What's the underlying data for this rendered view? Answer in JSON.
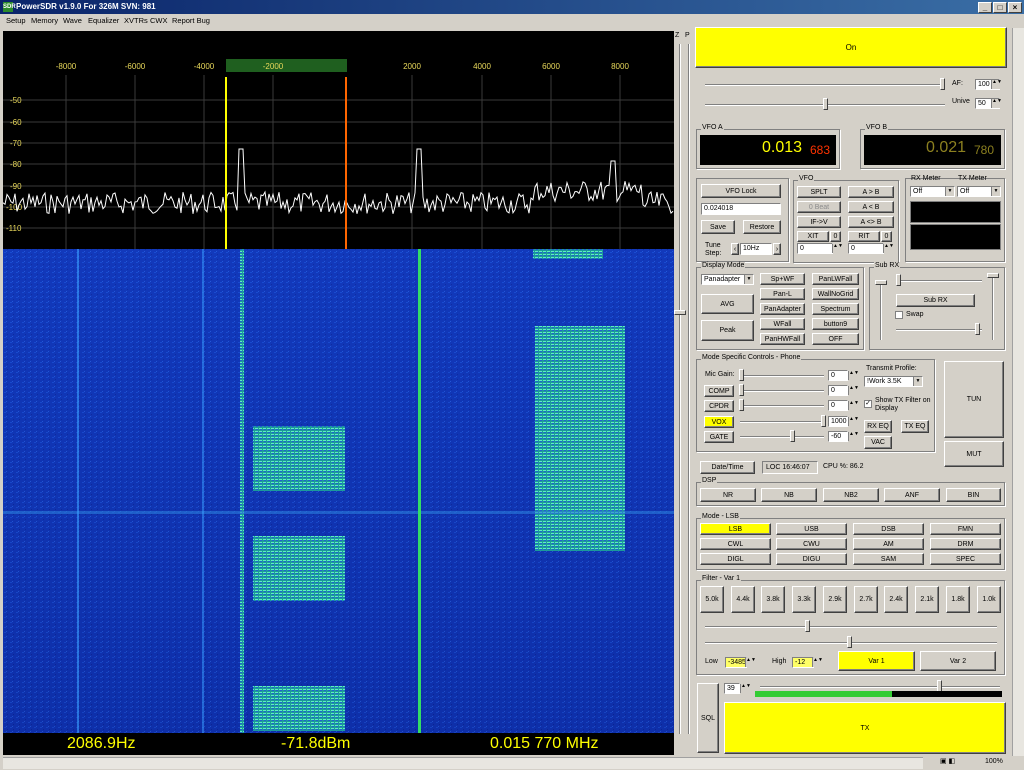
{
  "window": {
    "title": "PowerSDR v1.9.0 For 326M SVN: 981",
    "icon": "sdr-icon",
    "controls": [
      "minimize-icon",
      "maximize-icon",
      "close-icon"
    ]
  },
  "menu": [
    "Setup",
    "Memory",
    "Wave",
    "Equalizer",
    "XVTRs",
    "CWX",
    "Report Bug"
  ],
  "display": {
    "freq_ticks": [
      "-8000",
      "-6000",
      "-4000",
      "-2000",
      "2000",
      "4000",
      "6000",
      "8000"
    ],
    "db_ticks": [
      "-50",
      "-60",
      "-70",
      "-80",
      "-90",
      "-100",
      "-110"
    ],
    "filter_color": "#1f5f1f",
    "vfo_line_color": "#ff6600",
    "filter_edge_color": "#ffff00",
    "trace_color": "#ffffff",
    "waterfall_color": "#0a2aa8"
  },
  "status": {
    "cursor_freq": "2086.9Hz",
    "cursor_level": "-71.8dBm",
    "cursor_mhz": "0.015 770 MHz"
  },
  "side_strip": {
    "z": "Z",
    "p": "P"
  },
  "power_button": "On",
  "af": {
    "label": "AF:",
    "value": "100"
  },
  "usb_vol": {
    "label": "Unive",
    "value": "50"
  },
  "vfo_a": {
    "label": "VFO A",
    "main": "0.013",
    "fine": "683"
  },
  "vfo_b": {
    "label": "VFO B",
    "main": "0.021",
    "fine": "780"
  },
  "vfo_panel": {
    "lock": "VFO Lock",
    "memory_freq": "0.024018",
    "save": "Save",
    "restore": "Restore",
    "tune_step_label": "Tune Step:",
    "tune_step_value": "10Hz",
    "group_label": "VFO",
    "split": "SPLT",
    "a_to_b": "A > B",
    "zero_beat": "0 Beat",
    "b_to_a": "A < B",
    "if_v": "IF->V",
    "swap": "A <> B",
    "xit": "XIT",
    "xit_zero": "0",
    "xit_value": "0",
    "rit": "RIT",
    "rit_zero": "0",
    "rit_value": "0"
  },
  "meters": {
    "rx_label": "RX Meter",
    "rx_value": "Off",
    "tx_label": "TX Meter",
    "tx_value": "Off"
  },
  "display_mode": {
    "label": "Display Mode",
    "value": "Panadapter",
    "avg": "AVG",
    "peak": "Peak",
    "buttons": [
      "Sp+WF",
      "PanLWFall",
      "Pan-L",
      "WallNoGrid",
      "PanAdapter",
      "Spectrum",
      "WFall",
      "button9",
      "PanHWFall",
      "OFF"
    ]
  },
  "sub_rx": {
    "label": "Sub RX",
    "button": "Sub RX",
    "swap": "Swap"
  },
  "mode_controls": {
    "label": "Mode Specific Controls - Phone",
    "mic_gain": "Mic Gain:",
    "mic_value": "0",
    "comp": "COMP",
    "comp_value": "0",
    "cpdr": "CPDR",
    "cpdr_value": "0",
    "vox": "VOX",
    "vox_value": "1000",
    "gate": "GATE",
    "gate_value": "-60",
    "tx_profile_label": "Transmit Profile:",
    "tx_profile_value": "!Work 3.5K",
    "show_tx_filter": "Show TX Filter on Display",
    "rx_eq": "RX EQ",
    "tx_eq": "TX EQ",
    "vac": "VAC"
  },
  "tun": "TUN",
  "mut": "MUT",
  "info": {
    "date_time": "Date/Time",
    "loc": "LOC 16:46:07",
    "cpu": "CPU %: 86.2"
  },
  "dsp": {
    "label": "DSP",
    "buttons": [
      "NR",
      "NB",
      "NB2",
      "ANF",
      "BIN"
    ]
  },
  "modes": {
    "label": "Mode - LSB",
    "buttons": [
      "LSB",
      "USB",
      "DSB",
      "FMN",
      "CWL",
      "CWU",
      "AM",
      "DRM",
      "DIGL",
      "DIGU",
      "SAM",
      "SPEC"
    ],
    "active": "LSB"
  },
  "filter": {
    "label": "Filter - Var 1",
    "buttons": [
      "5.0k",
      "4.4k",
      "3.8k",
      "3.3k",
      "2.9k",
      "2.7k",
      "2.4k",
      "2.1k",
      "1.8k",
      "1.0k"
    ],
    "low_label": "Low",
    "low_value": "-3485",
    "high_label": "High",
    "high_value": "-12",
    "var1": "Var 1",
    "var2": "Var 2"
  },
  "squelch": {
    "label": "SQL",
    "value": "39"
  },
  "tx_button": "TX",
  "zoom": "100%"
}
